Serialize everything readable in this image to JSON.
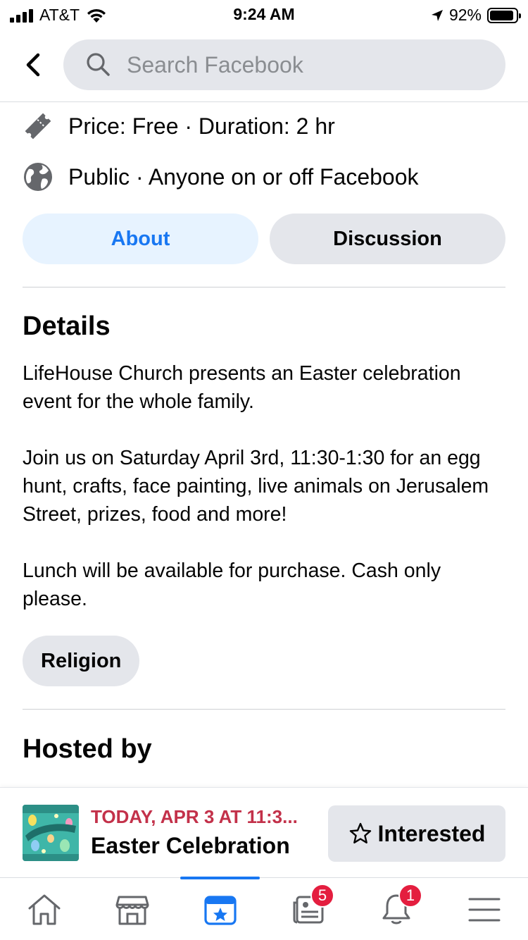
{
  "status_bar": {
    "carrier": "AT&T",
    "time": "9:24 AM",
    "battery_text": "92%",
    "battery_level": 0.92
  },
  "header": {
    "search_placeholder": "Search Facebook"
  },
  "event_info": {
    "price_duration": "Price: Free · Duration: 2 hr",
    "privacy": "Public · Anyone on or off Facebook"
  },
  "tabs": [
    {
      "label": "About",
      "active": true
    },
    {
      "label": "Discussion",
      "active": false
    }
  ],
  "details": {
    "title": "Details",
    "paragraphs": [
      "LifeHouse Church presents an Easter celebration event for the whole family.",
      "Join us on Saturday April 3rd, 11:30-1:30 for an egg hunt, crafts, face painting, live animals on Jerusalem Street, prizes, food and more!",
      "Lunch will be available for purchase. Cash only please."
    ],
    "category": "Religion"
  },
  "hosted_by": {
    "title": "Hosted by"
  },
  "event_bar": {
    "date": "TODAY, APR 3 AT 11:3...",
    "name": "Easter Celebration",
    "interested_label": "Interested"
  },
  "nav": {
    "items": [
      {
        "icon": "home-icon"
      },
      {
        "icon": "marketplace-icon"
      },
      {
        "icon": "events-icon",
        "active": true
      },
      {
        "icon": "news-feed-icon",
        "badge": "5"
      },
      {
        "icon": "notifications-icon",
        "badge": "1"
      },
      {
        "icon": "menu-icon"
      }
    ]
  },
  "colors": {
    "accent": "#1877f2",
    "date_red": "#c3314a",
    "badge_red": "#e41e3f"
  }
}
